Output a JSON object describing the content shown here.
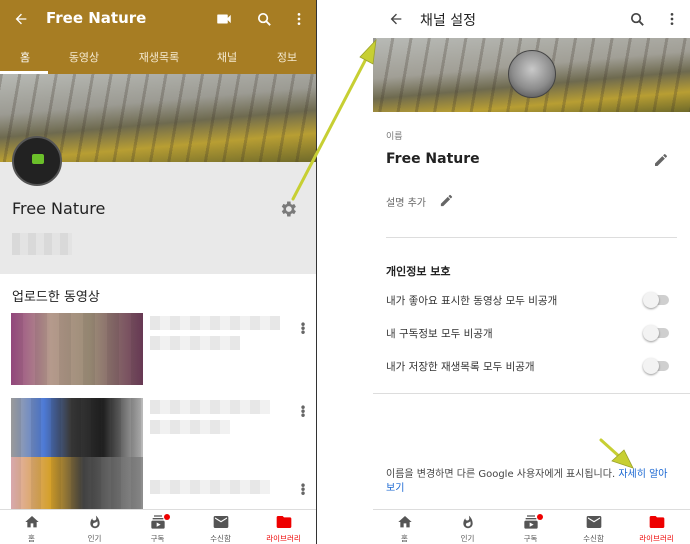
{
  "left": {
    "title": "Free Nature",
    "tabs": [
      "홈",
      "동영상",
      "재생목록",
      "채널",
      "정보"
    ],
    "channel_name": "Free Nature",
    "section_title": "업로드한 동영상"
  },
  "right": {
    "title": "채널 설정",
    "name_label": "이름",
    "name_value": "Free Nature",
    "desc_label": "설명 추가",
    "privacy_heading": "개인정보 보호",
    "privacy_rows": [
      {
        "label": "내가 좋아요 표시한 동영상 모두 비공개",
        "enabled": false
      },
      {
        "label": "내 구독정보 모두 비공개",
        "enabled": false
      },
      {
        "label": "내가 저장한 재생목록 모두 비공개",
        "enabled": false
      }
    ],
    "footer_text": "이름을 변경하면 다른 Google 사용자에게 표시됩니다.",
    "footer_link": "자세히 알아보기"
  },
  "bottom_nav": [
    {
      "label": "홈",
      "icon": "home-icon"
    },
    {
      "label": "인기",
      "icon": "fire-icon"
    },
    {
      "label": "구독",
      "icon": "subscriptions-icon"
    },
    {
      "label": "수신함",
      "icon": "mail-icon"
    },
    {
      "label": "라이브러리",
      "icon": "folder-icon"
    }
  ],
  "colors": {
    "appbar": "#a77d23",
    "active_nav": "#ee0000",
    "link": "#1a67d2",
    "annotation_arrow": "#c7cf33"
  }
}
